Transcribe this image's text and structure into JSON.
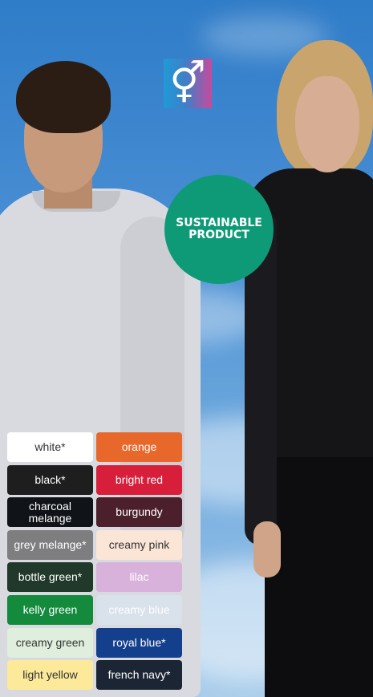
{
  "gender_icon": {
    "name": "unisex-gender-icon",
    "glyph": "⚥"
  },
  "badge": {
    "line1": "SUSTAINABLE",
    "line2": "PRODUCT",
    "color": "#0e9a76"
  },
  "swatches": [
    {
      "label": "white*",
      "bg": "#ffffff",
      "fg": "#333333"
    },
    {
      "label": "orange",
      "bg": "#e8672a",
      "fg": "#ffffff"
    },
    {
      "label": "black*",
      "bg": "#1e1e1e",
      "fg": "#ffffff"
    },
    {
      "label": "bright red",
      "bg": "#d71f3b",
      "fg": "#ffffff"
    },
    {
      "label": "charcoal melange",
      "bg": "#101418",
      "fg": "#ffffff"
    },
    {
      "label": "burgundy",
      "bg": "#4b1f2b",
      "fg": "#ffffff"
    },
    {
      "label": "grey melange*",
      "bg": "#7e7d80",
      "fg": "#ffffff"
    },
    {
      "label": "creamy pink",
      "bg": "#fbe5d6",
      "fg": "#333333"
    },
    {
      "label": "bottle green*",
      "bg": "#20392a",
      "fg": "#ffffff"
    },
    {
      "label": "lilac",
      "bg": "#d9b2db",
      "fg": "#ffffff"
    },
    {
      "label": "kelly green",
      "bg": "#138a3c",
      "fg": "#ffffff"
    },
    {
      "label": "creamy blue",
      "bg": "#d9e1ea",
      "fg": "#ffffff"
    },
    {
      "label": "creamy green",
      "bg": "#dfeedd",
      "fg": "#333333"
    },
    {
      "label": "royal blue*",
      "bg": "#143f8d",
      "fg": "#ffffff"
    },
    {
      "label": "light yellow",
      "bg": "#fce99a",
      "fg": "#333333"
    },
    {
      "label": "french navy*",
      "bg": "#1c2533",
      "fg": "#ffffff"
    }
  ]
}
